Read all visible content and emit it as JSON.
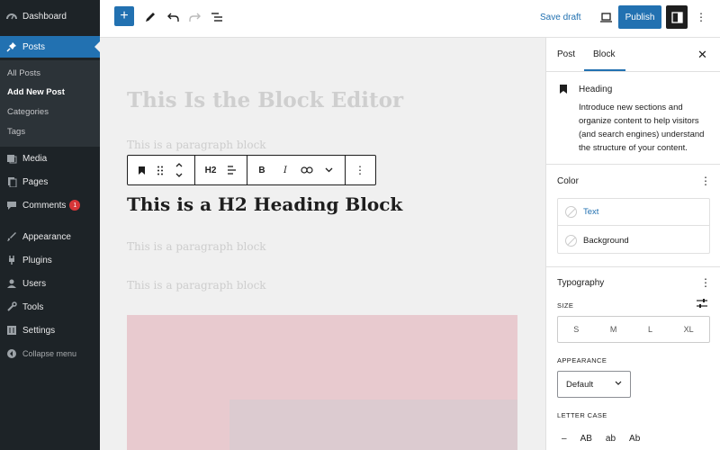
{
  "admin_menu": {
    "dashboard": "Dashboard",
    "posts": "Posts",
    "posts_sub": [
      "All Posts",
      "Add New Post",
      "Categories",
      "Tags"
    ],
    "media": "Media",
    "pages": "Pages",
    "comments": "Comments",
    "comments_count": "1",
    "appearance": "Appearance",
    "plugins": "Plugins",
    "users": "Users",
    "tools": "Tools",
    "settings": "Settings",
    "collapse": "Collapse menu"
  },
  "topbar": {
    "add_icon": "+",
    "save_draft": "Save draft",
    "publish": "Publish",
    "more_icon": "⋮"
  },
  "editor": {
    "title": "This Is the Block Editor",
    "paragraph1": "This is a paragraph block",
    "heading": "This is a H2 Heading Block",
    "paragraph2": "This is a paragraph block",
    "paragraph3": "This is a paragraph block",
    "toolbar": {
      "heading_level": "H2",
      "bold": "B",
      "italic": "I",
      "more": "⋮"
    }
  },
  "sidebar": {
    "tabs": [
      "Post",
      "Block"
    ],
    "active_tab": "Block",
    "close": "✕",
    "block_name": "Heading",
    "block_description": "Introduce new sections and organize content to help visitors (and search engines) understand the structure of your content.",
    "color_title": "Color",
    "color_rows": [
      "Text",
      "Background"
    ],
    "typography_title": "Typography",
    "size_label": "SIZE",
    "size_options": [
      "S",
      "M",
      "L",
      "XL"
    ],
    "appearance_label": "APPEARANCE",
    "appearance_value": "Default",
    "letter_case_label": "LETTER CASE",
    "letter_case_options": [
      "–",
      "AB",
      "ab",
      "Ab"
    ],
    "kebab": "⋮"
  },
  "colors": {
    "admin_bg": "#1d2327",
    "accent": "#2271b1",
    "canvas_bg": "#f0f0f0",
    "image_block": "#e8cacf"
  }
}
